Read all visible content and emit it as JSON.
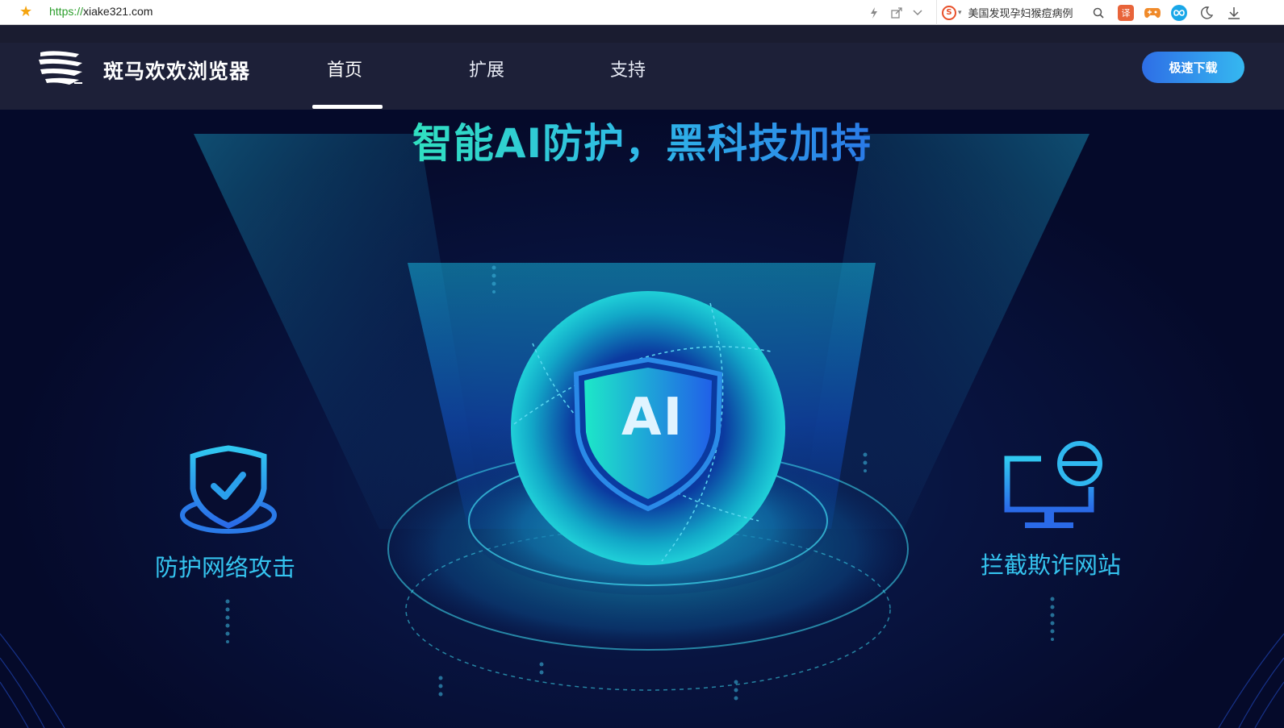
{
  "browser": {
    "url_protocol": "https://",
    "url_host": "xiake321.com",
    "news_text": "美国发现孕妇猴痘病例",
    "ext_translate_label": "译"
  },
  "site": {
    "brand": "斑马欢欢浏览器",
    "nav": [
      "首页",
      "扩展",
      "支持"
    ],
    "active_nav": "首页",
    "download_button": "极速下载"
  },
  "hero": {
    "headline": "智能AI防护，黑科技加持",
    "center_badge": "AI",
    "left_feature": "防护网络攻击",
    "right_feature": "拦截欺诈网站"
  },
  "colors": {
    "accent_cyan": "#35c4ef",
    "download_gradient_start": "#2e6ee6",
    "download_gradient_end": "#35b8f0",
    "nav_bg": "#1d2038",
    "hero_bg": "#050a2a"
  },
  "icons": {
    "bookmark": "star-icon",
    "speed": "lightning-icon",
    "share": "share-icon",
    "dropdown": "chevron-down-icon",
    "search_engine": "sogou-icon",
    "search": "search-icon",
    "game": "gamepad-icon",
    "extension": "infinity-icon",
    "night": "moon-icon",
    "download": "download-icon",
    "left_feature": "shield-check-icon",
    "right_feature": "monitor-block-icon"
  }
}
